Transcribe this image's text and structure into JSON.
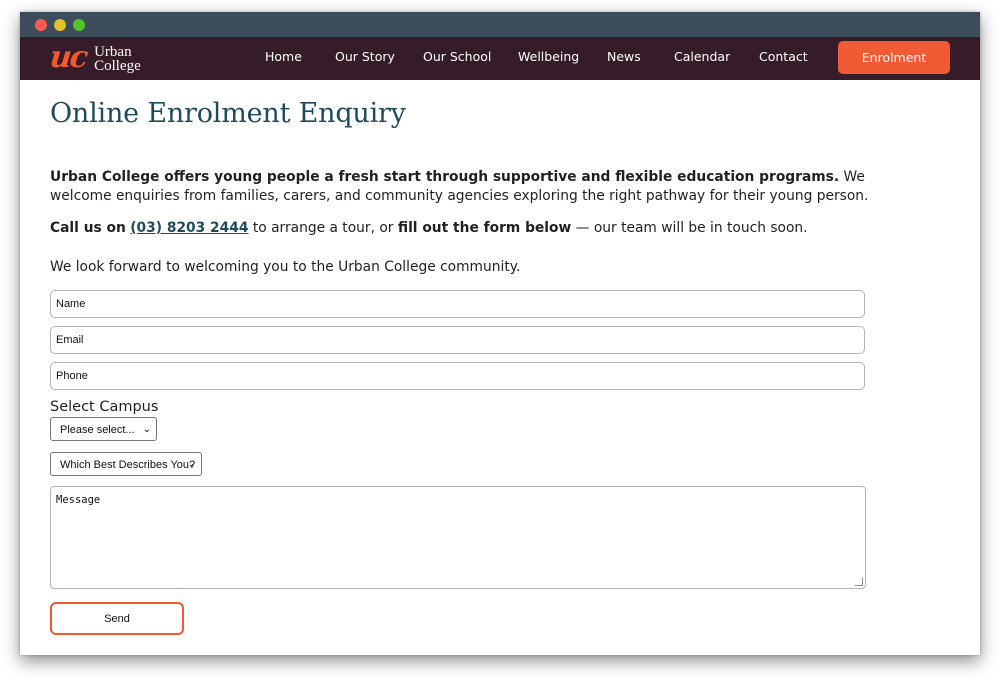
{
  "colors": {
    "nav_background": "#361c28",
    "accent": "#f05a35",
    "heading": "#1f4b5e",
    "titlebar": "#3d4d5c"
  },
  "window": {
    "controls": [
      "close",
      "minimize",
      "maximize"
    ]
  },
  "brand": {
    "mark": "uc",
    "name_line1": "Urban",
    "name_line2": "College"
  },
  "nav": {
    "items": [
      "Home",
      "Our Story",
      "Our School",
      "Wellbeing",
      "News",
      "Calendar",
      "Contact"
    ],
    "cta": "Enrolment"
  },
  "page": {
    "title": "Online Enrolment Enquiry",
    "intro_bold": "Urban College offers young people a fresh start through supportive and flexible education programs.",
    "intro_rest": " We welcome enquiries from families, carers, and community agencies exploring the right pathway for their young person.",
    "call_prefix": "Call us on",
    "phone": "(03) 8203 2444",
    "call_middle": " to arrange a tour, or ",
    "call_bold": "fill out the form below",
    "call_suffix": " — our team will be in touch soon.",
    "closing": "We look forward to welcoming you to the Urban College community."
  },
  "form": {
    "name_placeholder": "Name",
    "email_placeholder": "Email",
    "phone_placeholder": "Phone",
    "campus_label": "Select Campus",
    "campus_selected": "Please select...",
    "describe_selected": "Which Best Describes You?",
    "message_placeholder": "Message",
    "send_label": "Send"
  }
}
